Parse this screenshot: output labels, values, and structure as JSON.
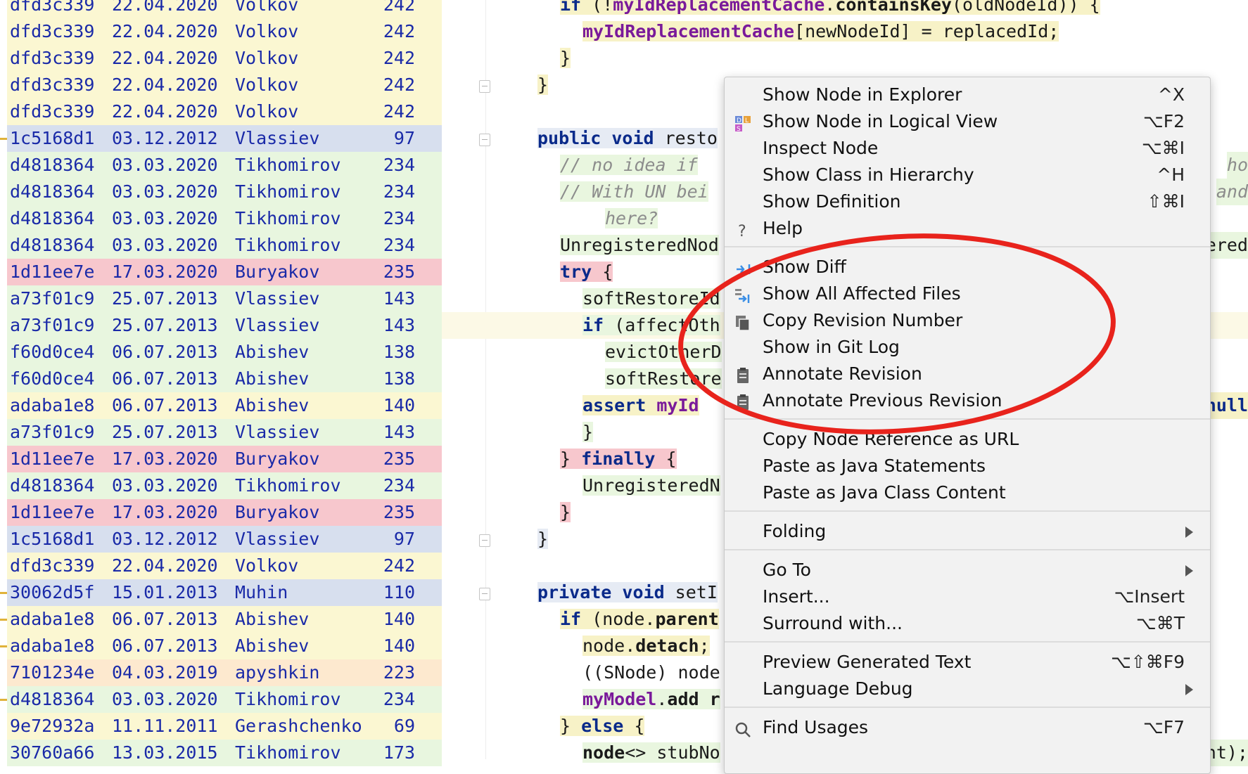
{
  "annotations": [
    {
      "hash": "dfd3c339",
      "date": "22.04.2020",
      "author": "Volkov",
      "line": "242",
      "color": "yellow"
    },
    {
      "hash": "dfd3c339",
      "date": "22.04.2020",
      "author": "Volkov",
      "line": "242",
      "color": "yellow"
    },
    {
      "hash": "dfd3c339",
      "date": "22.04.2020",
      "author": "Volkov",
      "line": "242",
      "color": "yellow"
    },
    {
      "hash": "dfd3c339",
      "date": "22.04.2020",
      "author": "Volkov",
      "line": "242",
      "color": "yellow"
    },
    {
      "hash": "dfd3c339",
      "date": "22.04.2020",
      "author": "Volkov",
      "line": "242",
      "color": "yellow"
    },
    {
      "hash": "1c5168d1",
      "date": "03.12.2012",
      "author": "Vlassiev",
      "line": "97",
      "color": "blue"
    },
    {
      "hash": "d4818364",
      "date": "03.03.2020",
      "author": "Tikhomirov",
      "line": "234",
      "color": "green"
    },
    {
      "hash": "d4818364",
      "date": "03.03.2020",
      "author": "Tikhomirov",
      "line": "234",
      "color": "green"
    },
    {
      "hash": "d4818364",
      "date": "03.03.2020",
      "author": "Tikhomirov",
      "line": "234",
      "color": "green"
    },
    {
      "hash": "d4818364",
      "date": "03.03.2020",
      "author": "Tikhomirov",
      "line": "234",
      "color": "green"
    },
    {
      "hash": "1d11ee7e",
      "date": "17.03.2020",
      "author": "Buryakov",
      "line": "235",
      "color": "red"
    },
    {
      "hash": "a73f01c9",
      "date": "25.07.2013",
      "author": "Vlassiev",
      "line": "143",
      "color": "green"
    },
    {
      "hash": "a73f01c9",
      "date": "25.07.2013",
      "author": "Vlassiev",
      "line": "143",
      "color": "green"
    },
    {
      "hash": "f60d0ce4",
      "date": "06.07.2013",
      "author": "Abishev",
      "line": "138",
      "color": "green"
    },
    {
      "hash": "f60d0ce4",
      "date": "06.07.2013",
      "author": "Abishev",
      "line": "138",
      "color": "green"
    },
    {
      "hash": "adaba1e8",
      "date": "06.07.2013",
      "author": "Abishev",
      "line": "140",
      "color": "yellow"
    },
    {
      "hash": "a73f01c9",
      "date": "25.07.2013",
      "author": "Vlassiev",
      "line": "143",
      "color": "green"
    },
    {
      "hash": "1d11ee7e",
      "date": "17.03.2020",
      "author": "Buryakov",
      "line": "235",
      "color": "red"
    },
    {
      "hash": "d4818364",
      "date": "03.03.2020",
      "author": "Tikhomirov",
      "line": "234",
      "color": "green"
    },
    {
      "hash": "1d11ee7e",
      "date": "17.03.2020",
      "author": "Buryakov",
      "line": "235",
      "color": "red"
    },
    {
      "hash": "1c5168d1",
      "date": "03.12.2012",
      "author": "Vlassiev",
      "line": "97",
      "color": "blue"
    },
    {
      "hash": "dfd3c339",
      "date": "22.04.2020",
      "author": "Volkov",
      "line": "242",
      "color": "yellow"
    },
    {
      "hash": "30062d5f",
      "date": "15.01.2013",
      "author": "Muhin",
      "line": "110",
      "color": "blue"
    },
    {
      "hash": "adaba1e8",
      "date": "06.07.2013",
      "author": "Abishev",
      "line": "140",
      "color": "yellow"
    },
    {
      "hash": "adaba1e8",
      "date": "06.07.2013",
      "author": "Abishev",
      "line": "140",
      "color": "yellow"
    },
    {
      "hash": "7101234e",
      "date": "04.03.2019",
      "author": "apyshkin",
      "line": "223",
      "color": "peach"
    },
    {
      "hash": "d4818364",
      "date": "03.03.2020",
      "author": "Tikhomirov",
      "line": "234",
      "color": "green"
    },
    {
      "hash": "9e72932a",
      "date": "11.11.2011",
      "author": "Gerashchenko",
      "line": "69",
      "color": "yellow"
    },
    {
      "hash": "30760a66",
      "date": "13.03.2015",
      "author": "Tikhomirov",
      "line": "173",
      "color": "green"
    }
  ],
  "code_lines": [
    {
      "indent": 2,
      "parts": [
        {
          "t": "if ",
          "c": "kw"
        },
        {
          "t": "(!",
          "c": "plain"
        },
        {
          "t": "myIdReplacementCache",
          "c": "fld"
        },
        {
          "t": ".",
          "c": "plain"
        },
        {
          "t": "containsKey",
          "c": "bold"
        },
        {
          "t": "(oldNodeId)) {",
          "c": "plain"
        }
      ],
      "bg": "ybg"
    },
    {
      "indent": 3,
      "parts": [
        {
          "t": "myIdReplacementCache",
          "c": "fld"
        },
        {
          "t": "[newNodeId] = replacedId;",
          "c": "plain"
        }
      ],
      "bg": "ybg"
    },
    {
      "indent": 2,
      "parts": [
        {
          "t": "}",
          "c": "plain"
        }
      ],
      "bg": "ybg"
    },
    {
      "indent": 1,
      "parts": [
        {
          "t": "}",
          "c": "plain"
        }
      ],
      "bg": "ybg"
    },
    {
      "indent": 0,
      "parts": [],
      "bg": ""
    },
    {
      "indent": 1,
      "parts": [
        {
          "t": "public void ",
          "c": "kw"
        },
        {
          "t": "resto",
          "c": "plain"
        }
      ],
      "bg": "bbg"
    },
    {
      "indent": 2,
      "parts": [
        {
          "t": "// no idea if",
          "c": "cmt"
        }
      ],
      "bg": "gbg",
      "tail": "ho",
      "tailc": "cmt"
    },
    {
      "indent": 2,
      "parts": [
        {
          "t": "// With UN bei",
          "c": "cmt"
        }
      ],
      "bg": "gbg",
      "tail": "and",
      "tailc": "cmt"
    },
    {
      "indent": 4,
      "parts": [
        {
          "t": "here?",
          "c": "cmt"
        }
      ],
      "bg": "gbg"
    },
    {
      "indent": 2,
      "parts": [
        {
          "t": "UnregisteredNod",
          "c": "plain"
        }
      ],
      "bg": "gbg",
      "tail": "ered",
      "tailc": "plain"
    },
    {
      "indent": 2,
      "parts": [
        {
          "t": "try ",
          "c": "kw"
        },
        {
          "t": "{",
          "c": "plain"
        }
      ],
      "bg": "rbg"
    },
    {
      "indent": 3,
      "parts": [
        {
          "t": "softRestoreId",
          "c": "plain"
        }
      ],
      "bg": "gbg"
    },
    {
      "indent": 3,
      "parts": [
        {
          "t": "if ",
          "c": "kw"
        },
        {
          "t": "(affectOth",
          "c": "plain"
        }
      ],
      "bg": "gbg"
    },
    {
      "indent": 4,
      "parts": [
        {
          "t": "evictOtherD",
          "c": "plain"
        }
      ],
      "bg": "gbg"
    },
    {
      "indent": 4,
      "parts": [
        {
          "t": "softRestore",
          "c": "plain"
        }
      ],
      "bg": "gbg"
    },
    {
      "indent": 3,
      "parts": [
        {
          "t": "assert ",
          "c": "kw"
        },
        {
          "t": "myId",
          "c": "fld"
        }
      ],
      "bg": "ybg",
      "tail": "null",
      "tailc": "kw"
    },
    {
      "indent": 3,
      "parts": [
        {
          "t": "}",
          "c": "plain"
        }
      ],
      "bg": "gbg"
    },
    {
      "indent": 2,
      "parts": [
        {
          "t": "} ",
          "c": "plain"
        },
        {
          "t": "finally ",
          "c": "kw"
        },
        {
          "t": "{",
          "c": "plain"
        }
      ],
      "bg": "rbg"
    },
    {
      "indent": 3,
      "parts": [
        {
          "t": "UnregisteredN",
          "c": "plain"
        }
      ],
      "bg": "gbg"
    },
    {
      "indent": 2,
      "parts": [
        {
          "t": "}",
          "c": "plain"
        }
      ],
      "bg": "rbg"
    },
    {
      "indent": 1,
      "parts": [
        {
          "t": "}",
          "c": "plain"
        }
      ],
      "bg": "bbg"
    },
    {
      "indent": 0,
      "parts": [],
      "bg": ""
    },
    {
      "indent": 1,
      "parts": [
        {
          "t": "private void ",
          "c": "kw"
        },
        {
          "t": "setI",
          "c": "plain"
        }
      ],
      "bg": "bbg"
    },
    {
      "indent": 2,
      "parts": [
        {
          "t": "if ",
          "c": "kw"
        },
        {
          "t": "(node.",
          "c": "plain"
        },
        {
          "t": "parent",
          "c": "bold"
        }
      ],
      "bg": "ybg"
    },
    {
      "indent": 3,
      "parts": [
        {
          "t": "node.",
          "c": "plain"
        },
        {
          "t": "detach",
          "c": "bold"
        },
        {
          "t": ";",
          "c": "plain"
        }
      ],
      "bg": "ybg"
    },
    {
      "indent": 3,
      "parts": [
        {
          "t": "((SNode) node",
          "c": "plain"
        }
      ],
      "bg": ""
    },
    {
      "indent": 3,
      "parts": [
        {
          "t": "myModel",
          "c": "fld"
        },
        {
          "t": ".",
          "c": "plain"
        },
        {
          "t": "add r",
          "c": "bold"
        }
      ],
      "bg": "gbg"
    },
    {
      "indent": 2,
      "parts": [
        {
          "t": "} ",
          "c": "plain"
        },
        {
          "t": "else ",
          "c": "kw"
        },
        {
          "t": "{",
          "c": "plain"
        }
      ],
      "bg": "ybg"
    },
    {
      "indent": 3,
      "parts": [
        {
          "t": "node",
          "c": "bold"
        },
        {
          "t": "<> stubNo",
          "c": "plain"
        }
      ],
      "bg": "gbg",
      "tail": "nt);",
      "tailc": "plain"
    }
  ],
  "menu": {
    "groups": [
      [
        {
          "label": "Show Node in Explorer",
          "shortcut": "^X",
          "icon": ""
        },
        {
          "label": "Show Node in Logical View",
          "shortcut": "⌥F2",
          "icon": "logical-view-icon"
        },
        {
          "label": "Inspect Node",
          "shortcut": "⌥⌘I",
          "icon": ""
        },
        {
          "label": "Show Class in Hierarchy",
          "shortcut": "^H",
          "icon": ""
        },
        {
          "label": "Show Definition",
          "shortcut": "⇧⌘I",
          "icon": ""
        },
        {
          "label": "Help",
          "shortcut": "",
          "icon": "help-icon"
        }
      ],
      [
        {
          "label": "Show Diff",
          "shortcut": "",
          "icon": "diff-icon"
        },
        {
          "label": "Show All Affected Files",
          "shortcut": "",
          "icon": "affected-files-icon"
        },
        {
          "label": "Copy Revision Number",
          "shortcut": "",
          "icon": "copy-icon"
        },
        {
          "label": "Show in Git Log",
          "shortcut": "",
          "icon": ""
        },
        {
          "label": "Annotate Revision",
          "shortcut": "",
          "icon": "annotate-icon"
        },
        {
          "label": "Annotate Previous Revision",
          "shortcut": "",
          "icon": "annotate-icon"
        }
      ],
      [
        {
          "label": "Copy Node Reference as URL",
          "shortcut": "",
          "icon": ""
        },
        {
          "label": "Paste as Java Statements",
          "shortcut": "",
          "icon": ""
        },
        {
          "label": "Paste as Java Class Content",
          "shortcut": "",
          "icon": ""
        }
      ],
      [
        {
          "label": "Folding",
          "shortcut": "",
          "icon": "",
          "submenu": true
        }
      ],
      [
        {
          "label": "Go To",
          "shortcut": "",
          "icon": "",
          "submenu": true
        },
        {
          "label": "Insert...",
          "shortcut": "⌥Insert",
          "icon": ""
        },
        {
          "label": "Surround with...",
          "shortcut": "⌥⌘T",
          "icon": ""
        }
      ],
      [
        {
          "label": "Preview Generated Text",
          "shortcut": "⌥⇧⌘F9",
          "icon": ""
        },
        {
          "label": "Language Debug",
          "shortcut": "",
          "icon": "",
          "submenu": true
        }
      ],
      [
        {
          "label": "Find Usages",
          "shortcut": "⌥F7",
          "icon": "search-icon"
        }
      ]
    ]
  },
  "colors": {
    "annotation_yellow": "#fbf7d2",
    "annotation_green": "#e8f6df",
    "annotation_blue": "#d7dfee",
    "annotation_red": "#f7c7cd",
    "annotation_peach": "#fde9cf",
    "keyword": "#0a2a8a",
    "field": "#7a1a9a",
    "highlight_ellipse": "#e8231c"
  }
}
